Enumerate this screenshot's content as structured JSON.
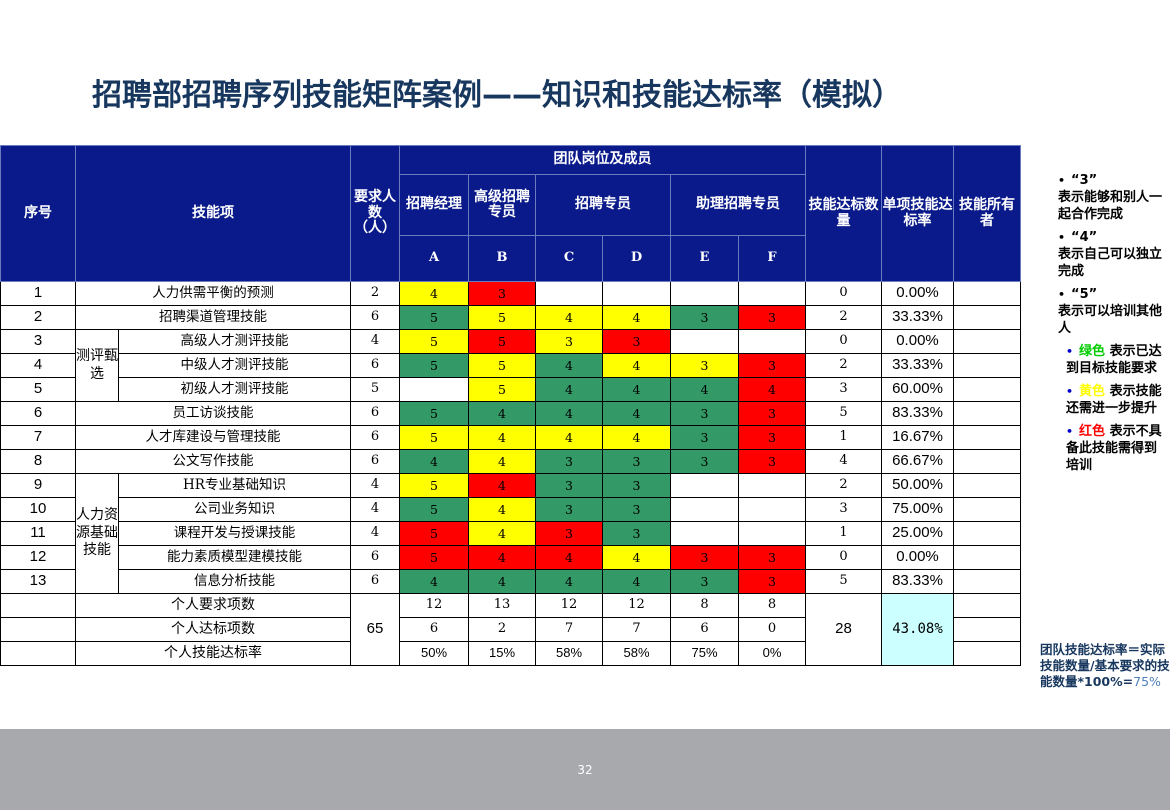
{
  "title": "招聘部招聘序列技能矩阵案例——知识和技能达标率（模拟）",
  "header": {
    "seq": "序号",
    "skill": "技能项",
    "required": "要求人数（人）",
    "team": "团队岗位及成员",
    "positions": [
      "招聘经理",
      "高级招聘专员",
      "招聘专员",
      "助理招聘专员"
    ],
    "members": [
      "A",
      "B",
      "C",
      "D",
      "E",
      "F"
    ],
    "skill_count": "技能达标数量",
    "skill_rate": "单项技能达标率",
    "owner": "技能所有者"
  },
  "groups": {
    "assess": "测评甄选",
    "hr": "人力资源基础技能"
  },
  "rows": [
    {
      "no": "1",
      "skill": "人力供需平衡的预测",
      "req": "2",
      "cells": [
        {
          "v": "4",
          "c": "y"
        },
        {
          "v": "3",
          "c": "rd"
        },
        {
          "v": "",
          "c": "w"
        },
        {
          "v": "",
          "c": "w"
        },
        {
          "v": "",
          "c": "w"
        },
        {
          "v": "",
          "c": "w"
        }
      ],
      "count": "0",
      "rate": "0.00%"
    },
    {
      "no": "2",
      "skill": "招聘渠道管理技能",
      "req": "6",
      "cells": [
        {
          "v": "5",
          "c": "g"
        },
        {
          "v": "5",
          "c": "y"
        },
        {
          "v": "4",
          "c": "y"
        },
        {
          "v": "4",
          "c": "y"
        },
        {
          "v": "3",
          "c": "g"
        },
        {
          "v": "3",
          "c": "rd"
        }
      ],
      "count": "2",
      "rate": "33.33%"
    },
    {
      "no": "3",
      "skill": "高级人才测评技能",
      "req": "4",
      "cells": [
        {
          "v": "5",
          "c": "y"
        },
        {
          "v": "5",
          "c": "rd"
        },
        {
          "v": "3",
          "c": "y"
        },
        {
          "v": "3",
          "c": "rd"
        },
        {
          "v": "",
          "c": "w"
        },
        {
          "v": "",
          "c": "w"
        }
      ],
      "count": "0",
      "rate": "0.00%"
    },
    {
      "no": "4",
      "skill": "中级人才测评技能",
      "req": "6",
      "cells": [
        {
          "v": "5",
          "c": "g"
        },
        {
          "v": "5",
          "c": "y"
        },
        {
          "v": "4",
          "c": "g"
        },
        {
          "v": "4",
          "c": "y"
        },
        {
          "v": "3",
          "c": "y"
        },
        {
          "v": "3",
          "c": "rd"
        }
      ],
      "count": "2",
      "rate": "33.33%"
    },
    {
      "no": "5",
      "skill": "初级人才测评技能",
      "req": "5",
      "cells": [
        {
          "v": "",
          "c": "w"
        },
        {
          "v": "5",
          "c": "y"
        },
        {
          "v": "4",
          "c": "g"
        },
        {
          "v": "4",
          "c": "g"
        },
        {
          "v": "4",
          "c": "g"
        },
        {
          "v": "4",
          "c": "rd"
        }
      ],
      "count": "3",
      "rate": "60.00%"
    },
    {
      "no": "6",
      "skill": "员工访谈技能",
      "req": "6",
      "cells": [
        {
          "v": "5",
          "c": "g"
        },
        {
          "v": "4",
          "c": "g"
        },
        {
          "v": "4",
          "c": "g"
        },
        {
          "v": "4",
          "c": "g"
        },
        {
          "v": "3",
          "c": "g"
        },
        {
          "v": "3",
          "c": "rd"
        }
      ],
      "count": "5",
      "rate": "83.33%"
    },
    {
      "no": "7",
      "skill": "人才库建设与管理技能",
      "req": "6",
      "cells": [
        {
          "v": "5",
          "c": "y"
        },
        {
          "v": "4",
          "c": "y"
        },
        {
          "v": "4",
          "c": "y"
        },
        {
          "v": "4",
          "c": "y"
        },
        {
          "v": "3",
          "c": "g"
        },
        {
          "v": "3",
          "c": "rd"
        }
      ],
      "count": "1",
      "rate": "16.67%"
    },
    {
      "no": "8",
      "skill": "公文写作技能",
      "req": "6",
      "cells": [
        {
          "v": "4",
          "c": "g"
        },
        {
          "v": "4",
          "c": "y"
        },
        {
          "v": "3",
          "c": "g"
        },
        {
          "v": "3",
          "c": "g"
        },
        {
          "v": "3",
          "c": "g"
        },
        {
          "v": "3",
          "c": "rd"
        }
      ],
      "count": "4",
      "rate": "66.67%"
    },
    {
      "no": "9",
      "skill": "HR专业基础知识",
      "req": "4",
      "cells": [
        {
          "v": "5",
          "c": "y"
        },
        {
          "v": "4",
          "c": "rd"
        },
        {
          "v": "3",
          "c": "g"
        },
        {
          "v": "3",
          "c": "g"
        },
        {
          "v": "",
          "c": "w"
        },
        {
          "v": "",
          "c": "w"
        }
      ],
      "count": "2",
      "rate": "50.00%"
    },
    {
      "no": "10",
      "skill": "公司业务知识",
      "req": "4",
      "cells": [
        {
          "v": "5",
          "c": "g"
        },
        {
          "v": "4",
          "c": "y"
        },
        {
          "v": "3",
          "c": "g"
        },
        {
          "v": "3",
          "c": "g"
        },
        {
          "v": "",
          "c": "w"
        },
        {
          "v": "",
          "c": "w"
        }
      ],
      "count": "3",
      "rate": "75.00%"
    },
    {
      "no": "11",
      "skill": "课程开发与授课技能",
      "req": "4",
      "cells": [
        {
          "v": "5",
          "c": "rd"
        },
        {
          "v": "4",
          "c": "y"
        },
        {
          "v": "3",
          "c": "rd"
        },
        {
          "v": "3",
          "c": "g"
        },
        {
          "v": "",
          "c": "w"
        },
        {
          "v": "",
          "c": "w"
        }
      ],
      "count": "1",
      "rate": "25.00%"
    },
    {
      "no": "12",
      "skill": "能力素质模型建模技能",
      "req": "6",
      "cells": [
        {
          "v": "5",
          "c": "rd"
        },
        {
          "v": "4",
          "c": "rd"
        },
        {
          "v": "4",
          "c": "rd"
        },
        {
          "v": "4",
          "c": "y"
        },
        {
          "v": "3",
          "c": "rd"
        },
        {
          "v": "3",
          "c": "rd"
        }
      ],
      "count": "0",
      "rate": "0.00%"
    },
    {
      "no": "13",
      "skill": "信息分析技能",
      "req": "6",
      "cells": [
        {
          "v": "4",
          "c": "g"
        },
        {
          "v": "4",
          "c": "g"
        },
        {
          "v": "4",
          "c": "g"
        },
        {
          "v": "4",
          "c": "g"
        },
        {
          "v": "3",
          "c": "g"
        },
        {
          "v": "3",
          "c": "rd"
        }
      ],
      "count": "5",
      "rate": "83.33%"
    }
  ],
  "summary": {
    "req_items_label": "个人要求项数",
    "req_items": [
      "12",
      "13",
      "12",
      "12",
      "8",
      "8"
    ],
    "met_items_label": "个人达标项数",
    "met_items": [
      "6",
      "2",
      "7",
      "7",
      "6",
      "0"
    ],
    "personal_rate_label": "个人技能达标率",
    "personal_rate": [
      "50%",
      "15%",
      "58%",
      "58%",
      "75%",
      "0%"
    ],
    "total_required": "65",
    "total_met": "28",
    "team_rate": "43.08%"
  },
  "legend": {
    "l3_quote": "“3”",
    "l3_text": "表示能够和别人一起合作完成",
    "l4_quote": "“4”",
    "l4_text": "表示自己可以独立完成",
    "l5_quote": "“5”",
    "l5_text": "表示可以培训其他人",
    "green_word": "绿色",
    "green_text": "表示已达到目标技能要求",
    "yellow_word": "黄色",
    "yellow_text": "表示技能还需进一步提升",
    "red_word": "红色",
    "red_text": "表示不具备此技能需得到培训"
  },
  "formula": {
    "text": "团队技能达标率＝实际技能数量/基本要求的技能数量*100%=",
    "value": "75%"
  },
  "page_number": "32"
}
